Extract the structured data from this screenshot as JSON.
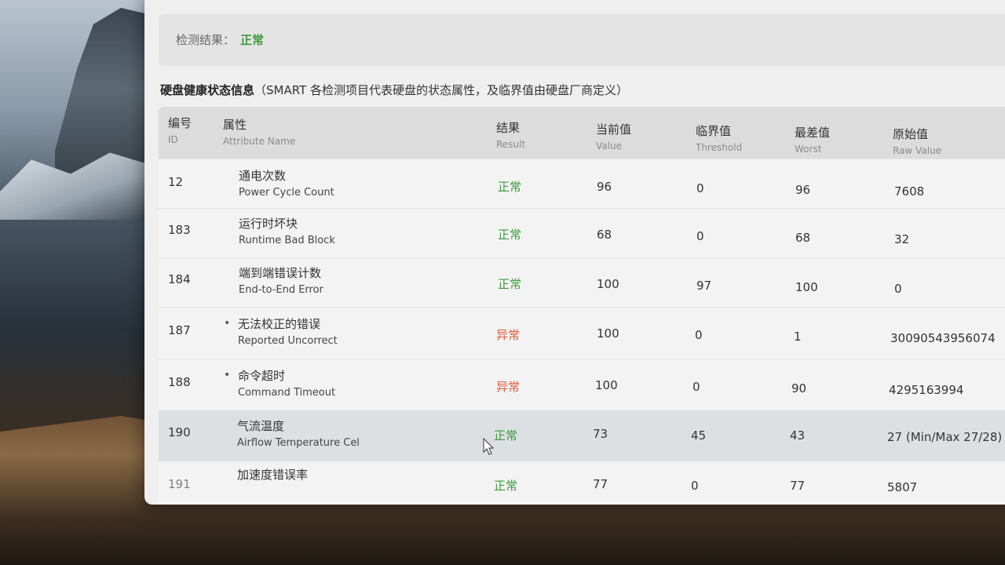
{
  "header": {
    "detect_label": "检测结果：",
    "detect_value": "正常"
  },
  "section_title": {
    "bold": "硬盘健康状态信息",
    "rest": "（SMART 各检测项目代表硬盘的状态属性，及临界值由硬盘厂商定义）"
  },
  "columns": {
    "id": {
      "cn": "编号",
      "en": "ID"
    },
    "attr": {
      "cn": "属性",
      "en": "Attribute Name"
    },
    "result": {
      "cn": "结果",
      "en": "Result"
    },
    "value": {
      "cn": "当前值",
      "en": "Value"
    },
    "threshold": {
      "cn": "临界值",
      "en": "Threshold"
    },
    "worst": {
      "cn": "最差值",
      "en": "Worst"
    },
    "raw": {
      "cn": "原始值",
      "en": "Raw Value"
    }
  },
  "rows": [
    {
      "id": "12",
      "cn": "通电次数",
      "en": "Power Cycle Count",
      "result": "正常",
      "status": "ok",
      "value": "96",
      "threshold": "0",
      "worst": "96",
      "raw": "7608"
    },
    {
      "id": "183",
      "cn": "运行时坏块",
      "en": "Runtime Bad Block",
      "result": "正常",
      "status": "ok",
      "value": "68",
      "threshold": "0",
      "worst": "68",
      "raw": "32"
    },
    {
      "id": "184",
      "cn": "端到端错误计数",
      "en": "End-to-End Error",
      "result": "正常",
      "status": "ok",
      "value": "100",
      "threshold": "97",
      "worst": "100",
      "raw": "0"
    },
    {
      "id": "187",
      "cn": "无法校正的错误",
      "en": "Reported Uncorrect",
      "result": "异常",
      "status": "bad",
      "value": "100",
      "threshold": "0",
      "worst": "1",
      "raw": "30090543956074"
    },
    {
      "id": "188",
      "cn": "命令超时",
      "en": "Command Timeout",
      "result": "异常",
      "status": "bad",
      "value": "100",
      "threshold": "0",
      "worst": "90",
      "raw": "4295163994"
    },
    {
      "id": "190",
      "cn": "气流温度",
      "en": "Airflow Temperature Cel",
      "result": "正常",
      "status": "ok",
      "value": "73",
      "threshold": "45",
      "worst": "43",
      "raw": "27 (Min/Max 27/28)"
    },
    {
      "id": "191",
      "cn": "加速度错误率",
      "en": "",
      "result": "正常",
      "status": "ok",
      "value": "77",
      "threshold": "0",
      "worst": "77",
      "raw": "5807"
    }
  ],
  "colors": {
    "ok": "#3c9a3c",
    "bad": "#e25a3a"
  }
}
